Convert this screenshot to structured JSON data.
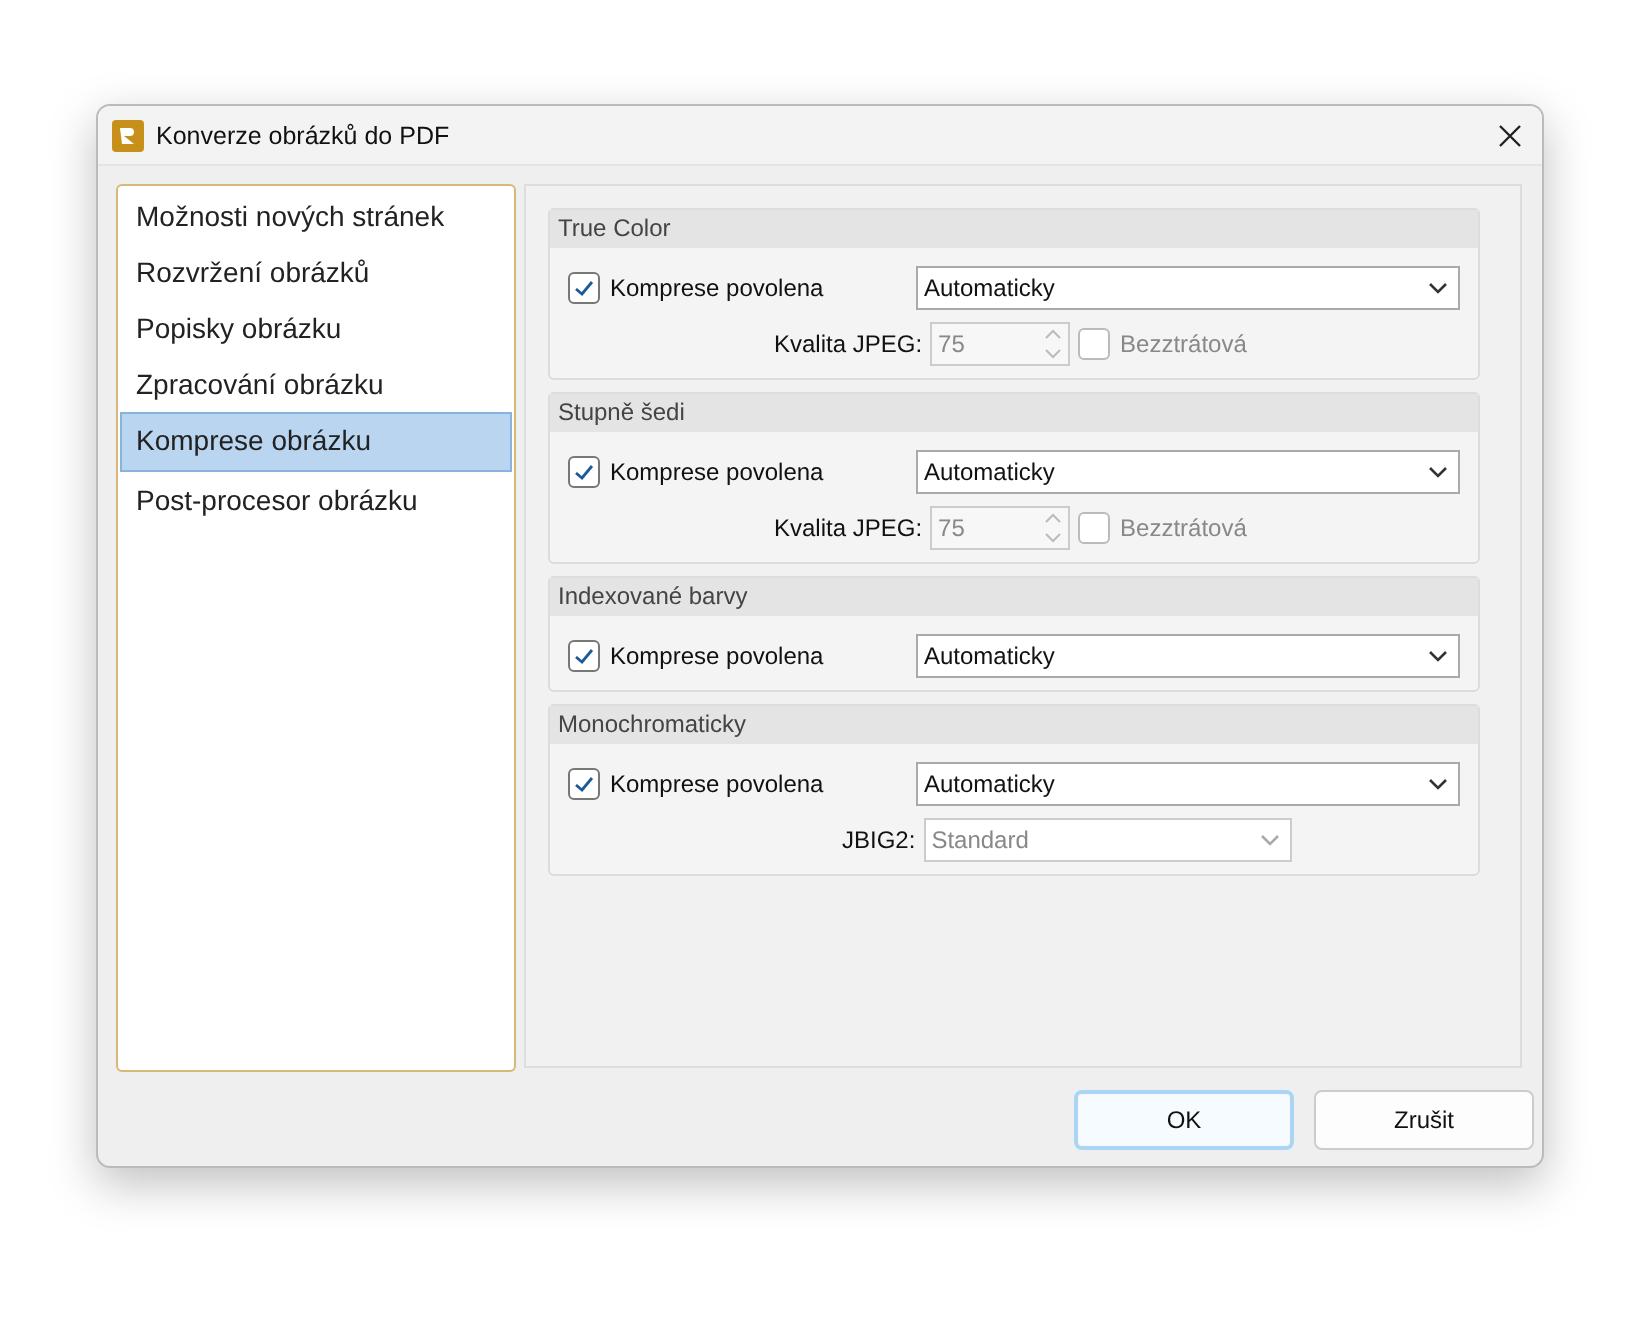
{
  "window": {
    "title": "Konverze obrázků do PDF"
  },
  "sidebar": {
    "items": [
      {
        "label": "Možnosti nových stránek",
        "selected": false
      },
      {
        "label": "Rozvržení obrázků",
        "selected": false
      },
      {
        "label": "Popisky obrázku",
        "selected": false
      },
      {
        "label": "Zpracování obrázku",
        "selected": false
      },
      {
        "label": "Komprese obrázku",
        "selected": true
      },
      {
        "label": "Post-procesor obrázku",
        "selected": false
      }
    ]
  },
  "sections": [
    {
      "title": "True Color",
      "checkbox": {
        "label": "Komprese povolena",
        "checked": true
      },
      "dropdown": "Automaticky",
      "extra": {
        "kind": "jpeg",
        "label": "Kvalita JPEG:",
        "value": "75",
        "lossless": {
          "label": "Bezztrátová",
          "checked": false
        }
      }
    },
    {
      "title": "Stupně šedi",
      "checkbox": {
        "label": "Komprese povolena",
        "checked": true
      },
      "dropdown": "Automaticky",
      "extra": {
        "kind": "jpeg",
        "label": "Kvalita JPEG:",
        "value": "75",
        "lossless": {
          "label": "Bezztrátová",
          "checked": false
        }
      }
    },
    {
      "title": "Indexované barvy",
      "checkbox": {
        "label": "Komprese povolena",
        "checked": true
      },
      "dropdown": "Automaticky"
    },
    {
      "title": "Monochromaticky",
      "checkbox": {
        "label": "Komprese povolena",
        "checked": true
      },
      "dropdown": "Automaticky",
      "extra": {
        "kind": "jbig2",
        "label": "JBIG2:",
        "value": "Standard"
      }
    }
  ],
  "buttons": [
    {
      "label": "OK",
      "default": true
    },
    {
      "label": "Zrušit",
      "default": false
    }
  ]
}
